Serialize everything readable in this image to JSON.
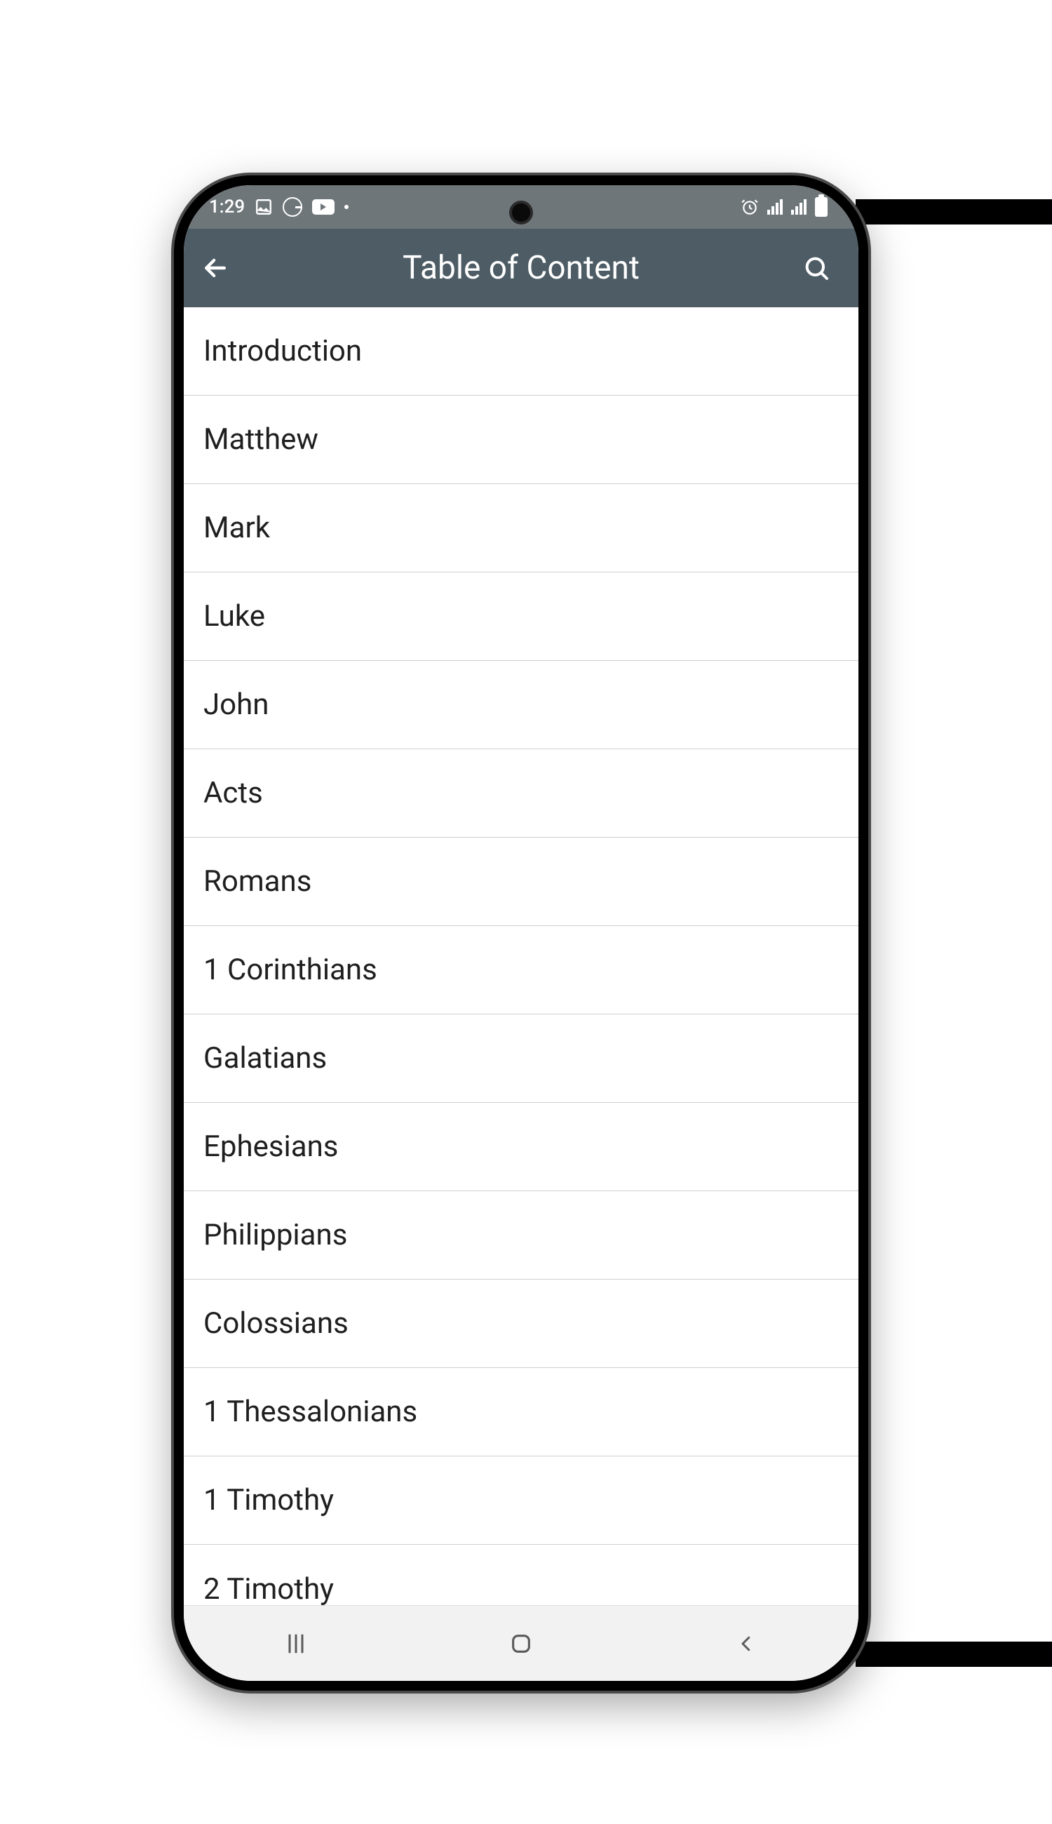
{
  "statusbar": {
    "time": "1:29",
    "left_icons": [
      "image-icon",
      "google-icon",
      "youtube-icon",
      "dot-icon"
    ],
    "right_icons": [
      "alarm-icon",
      "signal-icon",
      "signal-icon",
      "battery-icon"
    ]
  },
  "appbar": {
    "title": "Table of Content"
  },
  "toc": {
    "items": [
      "Introduction",
      "Matthew",
      "Mark",
      "Luke",
      "John",
      "Acts",
      "Romans",
      "1 Corinthians",
      "Galatians",
      "Ephesians",
      "Philippians",
      "Colossians",
      "1 Thessalonians",
      "1 Timothy",
      "2 Timothy"
    ]
  }
}
